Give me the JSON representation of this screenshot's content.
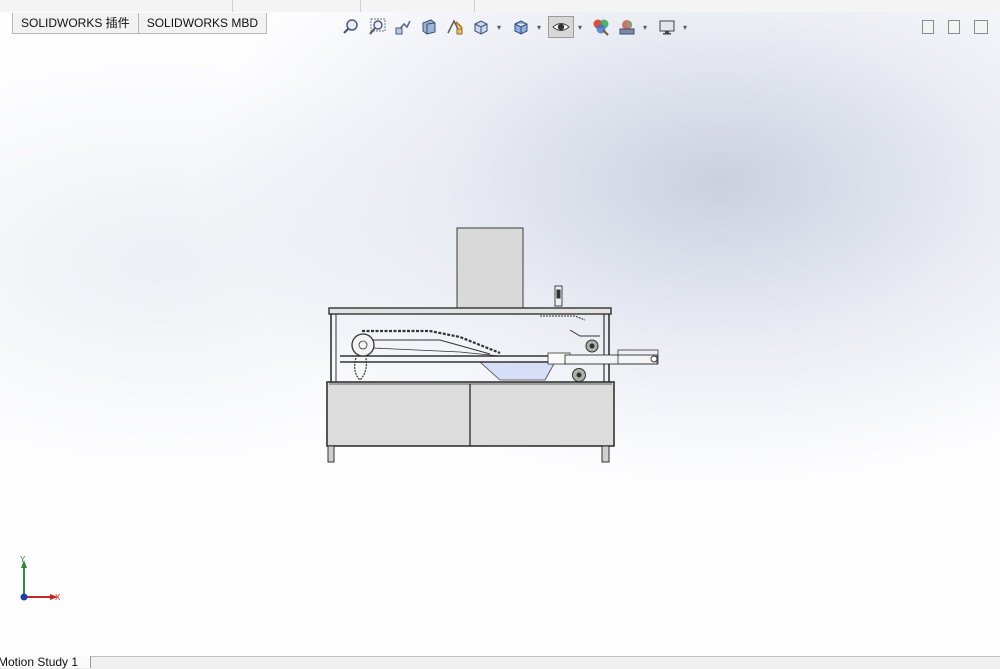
{
  "command_manager": {
    "tabs": [
      {
        "label": "SOLIDWORKS 插件"
      },
      {
        "label": "SOLIDWORKS MBD"
      }
    ]
  },
  "view_toolbar": {
    "icons": [
      "zoom-to-fit-icon",
      "zoom-to-area-icon",
      "previous-view-icon",
      "section-view-icon",
      "dynamic-annotation-view-icon",
      "view-orientation-icon",
      "display-style-icon",
      "hide-show-items-icon",
      "edit-appearance-icon",
      "apply-scene-icon",
      "view-settings-icon"
    ]
  },
  "triad": {
    "x_label": "X",
    "y_label": "Y"
  },
  "bottom_tabs": [
    {
      "label": "Motion Study 1"
    }
  ]
}
